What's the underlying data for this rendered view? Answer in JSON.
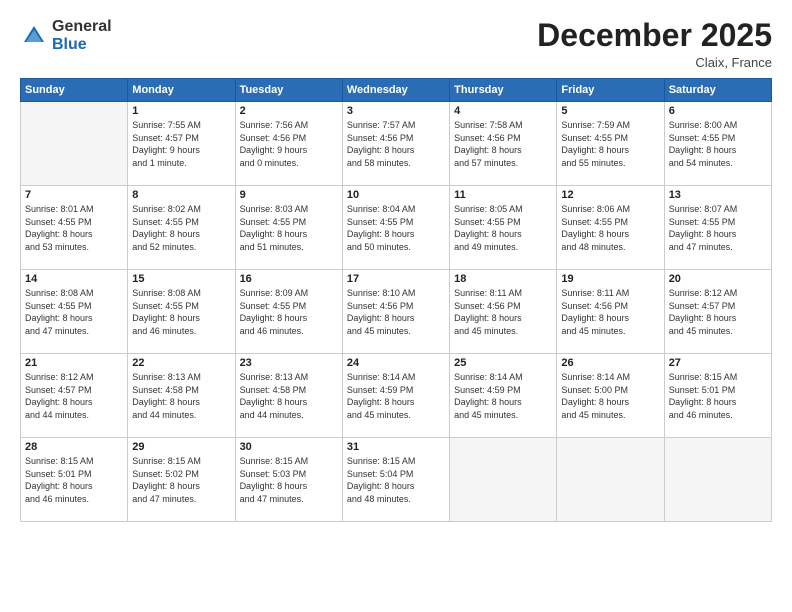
{
  "logo": {
    "general": "General",
    "blue": "Blue"
  },
  "title": {
    "month_year": "December 2025",
    "location": "Claix, France"
  },
  "days_of_week": [
    "Sunday",
    "Monday",
    "Tuesday",
    "Wednesday",
    "Thursday",
    "Friday",
    "Saturday"
  ],
  "weeks": [
    [
      {
        "day": "",
        "info": ""
      },
      {
        "day": "1",
        "info": "Sunrise: 7:55 AM\nSunset: 4:57 PM\nDaylight: 9 hours\nand 1 minute."
      },
      {
        "day": "2",
        "info": "Sunrise: 7:56 AM\nSunset: 4:56 PM\nDaylight: 9 hours\nand 0 minutes."
      },
      {
        "day": "3",
        "info": "Sunrise: 7:57 AM\nSunset: 4:56 PM\nDaylight: 8 hours\nand 58 minutes."
      },
      {
        "day": "4",
        "info": "Sunrise: 7:58 AM\nSunset: 4:56 PM\nDaylight: 8 hours\nand 57 minutes."
      },
      {
        "day": "5",
        "info": "Sunrise: 7:59 AM\nSunset: 4:55 PM\nDaylight: 8 hours\nand 55 minutes."
      },
      {
        "day": "6",
        "info": "Sunrise: 8:00 AM\nSunset: 4:55 PM\nDaylight: 8 hours\nand 54 minutes."
      }
    ],
    [
      {
        "day": "7",
        "info": "Sunrise: 8:01 AM\nSunset: 4:55 PM\nDaylight: 8 hours\nand 53 minutes."
      },
      {
        "day": "8",
        "info": "Sunrise: 8:02 AM\nSunset: 4:55 PM\nDaylight: 8 hours\nand 52 minutes."
      },
      {
        "day": "9",
        "info": "Sunrise: 8:03 AM\nSunset: 4:55 PM\nDaylight: 8 hours\nand 51 minutes."
      },
      {
        "day": "10",
        "info": "Sunrise: 8:04 AM\nSunset: 4:55 PM\nDaylight: 8 hours\nand 50 minutes."
      },
      {
        "day": "11",
        "info": "Sunrise: 8:05 AM\nSunset: 4:55 PM\nDaylight: 8 hours\nand 49 minutes."
      },
      {
        "day": "12",
        "info": "Sunrise: 8:06 AM\nSunset: 4:55 PM\nDaylight: 8 hours\nand 48 minutes."
      },
      {
        "day": "13",
        "info": "Sunrise: 8:07 AM\nSunset: 4:55 PM\nDaylight: 8 hours\nand 47 minutes."
      }
    ],
    [
      {
        "day": "14",
        "info": "Sunrise: 8:08 AM\nSunset: 4:55 PM\nDaylight: 8 hours\nand 47 minutes."
      },
      {
        "day": "15",
        "info": "Sunrise: 8:08 AM\nSunset: 4:55 PM\nDaylight: 8 hours\nand 46 minutes."
      },
      {
        "day": "16",
        "info": "Sunrise: 8:09 AM\nSunset: 4:55 PM\nDaylight: 8 hours\nand 46 minutes."
      },
      {
        "day": "17",
        "info": "Sunrise: 8:10 AM\nSunset: 4:56 PM\nDaylight: 8 hours\nand 45 minutes."
      },
      {
        "day": "18",
        "info": "Sunrise: 8:11 AM\nSunset: 4:56 PM\nDaylight: 8 hours\nand 45 minutes."
      },
      {
        "day": "19",
        "info": "Sunrise: 8:11 AM\nSunset: 4:56 PM\nDaylight: 8 hours\nand 45 minutes."
      },
      {
        "day": "20",
        "info": "Sunrise: 8:12 AM\nSunset: 4:57 PM\nDaylight: 8 hours\nand 45 minutes."
      }
    ],
    [
      {
        "day": "21",
        "info": "Sunrise: 8:12 AM\nSunset: 4:57 PM\nDaylight: 8 hours\nand 44 minutes."
      },
      {
        "day": "22",
        "info": "Sunrise: 8:13 AM\nSunset: 4:58 PM\nDaylight: 8 hours\nand 44 minutes."
      },
      {
        "day": "23",
        "info": "Sunrise: 8:13 AM\nSunset: 4:58 PM\nDaylight: 8 hours\nand 44 minutes."
      },
      {
        "day": "24",
        "info": "Sunrise: 8:14 AM\nSunset: 4:59 PM\nDaylight: 8 hours\nand 45 minutes."
      },
      {
        "day": "25",
        "info": "Sunrise: 8:14 AM\nSunset: 4:59 PM\nDaylight: 8 hours\nand 45 minutes."
      },
      {
        "day": "26",
        "info": "Sunrise: 8:14 AM\nSunset: 5:00 PM\nDaylight: 8 hours\nand 45 minutes."
      },
      {
        "day": "27",
        "info": "Sunrise: 8:15 AM\nSunset: 5:01 PM\nDaylight: 8 hours\nand 46 minutes."
      }
    ],
    [
      {
        "day": "28",
        "info": "Sunrise: 8:15 AM\nSunset: 5:01 PM\nDaylight: 8 hours\nand 46 minutes."
      },
      {
        "day": "29",
        "info": "Sunrise: 8:15 AM\nSunset: 5:02 PM\nDaylight: 8 hours\nand 47 minutes."
      },
      {
        "day": "30",
        "info": "Sunrise: 8:15 AM\nSunset: 5:03 PM\nDaylight: 8 hours\nand 47 minutes."
      },
      {
        "day": "31",
        "info": "Sunrise: 8:15 AM\nSunset: 5:04 PM\nDaylight: 8 hours\nand 48 minutes."
      },
      {
        "day": "",
        "info": ""
      },
      {
        "day": "",
        "info": ""
      },
      {
        "day": "",
        "info": ""
      }
    ]
  ]
}
